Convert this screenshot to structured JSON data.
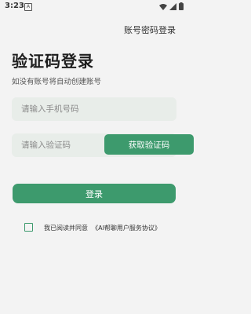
{
  "status_bar": {
    "time": "3:23",
    "notif_glyph": "A"
  },
  "header": {
    "password_login_link": "账号密码登录"
  },
  "main": {
    "title": "验证码登录",
    "subtitle": "如没有账号将自动创建账号",
    "phone_placeholder": "请输入手机号码",
    "code_placeholder": "请输入验证码",
    "get_code_label": "获取验证码",
    "login_label": "登录"
  },
  "agreement": {
    "prefix": "我已阅读并同意",
    "link_text": "《AI帮聊用户服务协议》"
  },
  "colors": {
    "accent": "#3d9a6d",
    "field_bg": "#e8ede9",
    "page_bg": "#f3f3f3"
  }
}
